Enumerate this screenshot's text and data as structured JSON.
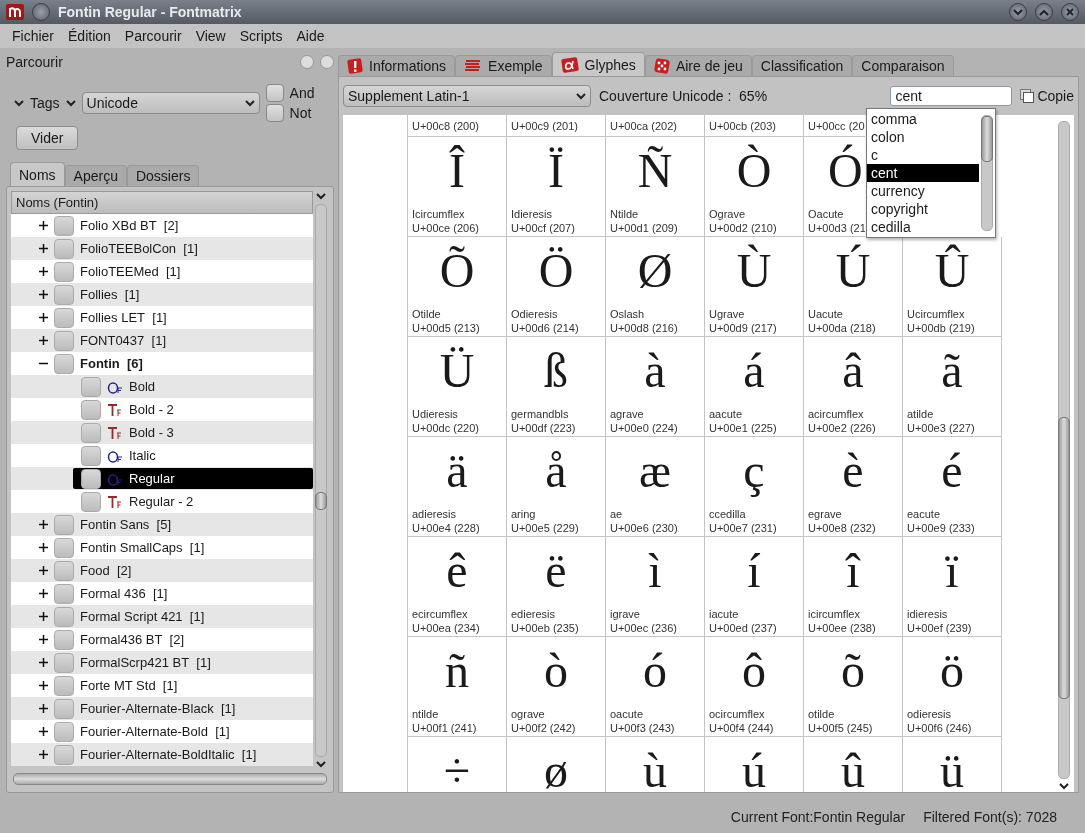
{
  "window": {
    "title": "Fontin Regular - Fontmatrix"
  },
  "menu": [
    "Fichier",
    "Édition",
    "Parcourir",
    "View",
    "Scripts",
    "Aide"
  ],
  "browse_panel": {
    "title": "Parcourir",
    "tags_label": "Tags",
    "tag_select": "Unicode",
    "filters": [
      {
        "label": "And",
        "checked": false
      },
      {
        "label": "Not",
        "checked": false
      }
    ],
    "clear_button": "Vider",
    "tabs": [
      {
        "label": "Noms",
        "selected": true
      },
      {
        "label": "Aperçu",
        "selected": false
      },
      {
        "label": "Dossiers",
        "selected": false
      }
    ],
    "tree": {
      "header": "Noms (Fontin)",
      "items": [
        {
          "label": "Folio XBd BT",
          "count": "[2]",
          "checked": false,
          "expanded": false
        },
        {
          "label": "FolioTEEBolCon",
          "count": "[1]",
          "checked": false,
          "expanded": false
        },
        {
          "label": "FolioTEEMed",
          "count": "[1]",
          "checked": false,
          "expanded": false
        },
        {
          "label": "Follies",
          "count": "[1]",
          "checked": false,
          "expanded": false
        },
        {
          "label": "Follies LET",
          "count": "[1]",
          "checked": false,
          "expanded": false
        },
        {
          "label": "FONT0437",
          "count": "[1]",
          "checked": false,
          "expanded": false
        },
        {
          "label": "Fontin",
          "count": "[6]",
          "checked": false,
          "expanded": true,
          "current": true,
          "children": [
            {
              "label": "Bold",
              "kind": "otf",
              "checked": false,
              "selected": false
            },
            {
              "label": "Bold - 2",
              "kind": "ttf",
              "checked": false,
              "selected": false
            },
            {
              "label": "Bold - 3",
              "kind": "ttf",
              "checked": false,
              "selected": false
            },
            {
              "label": "Italic",
              "kind": "otf",
              "checked": false,
              "selected": false
            },
            {
              "label": "Regular",
              "kind": "otf",
              "checked": false,
              "selected": true
            },
            {
              "label": "Regular - 2",
              "kind": "ttf",
              "checked": false,
              "selected": false
            }
          ]
        },
        {
          "label": "Fontin Sans",
          "count": "[5]",
          "checked": false,
          "expanded": false
        },
        {
          "label": "Fontin SmallCaps",
          "count": "[1]",
          "checked": false,
          "expanded": false
        },
        {
          "label": "Food",
          "count": "[2]",
          "checked": false,
          "expanded": false
        },
        {
          "label": "Formal 436",
          "count": "[1]",
          "checked": false,
          "expanded": false
        },
        {
          "label": "Formal Script 421",
          "count": "[1]",
          "checked": false,
          "expanded": false
        },
        {
          "label": "Formal436 BT",
          "count": "[2]",
          "checked": false,
          "expanded": false
        },
        {
          "label": "FormalScrp421 BT",
          "count": "[1]",
          "checked": false,
          "expanded": false
        },
        {
          "label": "Forte MT Std",
          "count": "[1]",
          "checked": false,
          "expanded": false
        },
        {
          "label": "Fourier-Alternate-Black",
          "count": "[1]",
          "checked": false,
          "expanded": false
        },
        {
          "label": "Fourier-Alternate-Bold",
          "count": "[1]",
          "checked": false,
          "expanded": false
        },
        {
          "label": "Fourier-Alternate-BoldItalic",
          "count": "[1]",
          "checked": false,
          "expanded": false
        }
      ]
    }
  },
  "main": {
    "tabs": [
      {
        "label": "Informations",
        "selected": false
      },
      {
        "label": "Exemple",
        "selected": false
      },
      {
        "label": "Glyphes",
        "selected": true
      },
      {
        "label": "Aire de jeu",
        "selected": false
      },
      {
        "label": "Classification",
        "selected": false
      },
      {
        "label": "Comparaison",
        "selected": false
      }
    ],
    "block_select": "Supplement Latin-1",
    "coverage": "Couverture Unicode :  65%",
    "search": {
      "value": "cent"
    },
    "copy_button": "Copie",
    "suggestions": [
      {
        "label": "comma",
        "selected": false
      },
      {
        "label": "colon",
        "selected": false
      },
      {
        "label": "c",
        "selected": false
      },
      {
        "label": "cent",
        "selected": true
      },
      {
        "label": "currency",
        "selected": false
      },
      {
        "label": "copyright",
        "selected": false
      },
      {
        "label": "cedilla",
        "selected": false
      }
    ],
    "glyph_rows": [
      [
        {
          "code": "U+00c8 (200)"
        },
        {
          "code": "U+00c9 (201)"
        },
        {
          "code": "U+00ca (202)"
        },
        {
          "code": "U+00cb (203)"
        },
        {
          "code": "U+00cc (20"
        }
      ],
      [
        {
          "glyph": "Î",
          "name": "Icircumflex",
          "code": "U+00ce (206)"
        },
        {
          "glyph": "Ï",
          "name": "Idieresis",
          "code": "U+00cf (207)"
        },
        {
          "glyph": "Ñ",
          "name": "Ntilde",
          "code": "U+00d1 (209)"
        },
        {
          "glyph": "Ò",
          "name": "Ograve",
          "code": "U+00d2 (210)"
        },
        {
          "glyph": "Ó",
          "name": "Oacute",
          "code": "U+00d3 (21"
        }
      ],
      [
        {
          "glyph": "Õ",
          "name": "Otilde",
          "code": "U+00d5 (213)"
        },
        {
          "glyph": "Ö",
          "name": "Odieresis",
          "code": "U+00d6 (214)"
        },
        {
          "glyph": "Ø",
          "name": "Oslash",
          "code": "U+00d8 (216)"
        },
        {
          "glyph": "Ù",
          "name": "Ugrave",
          "code": "U+00d9 (217)"
        },
        {
          "glyph": "Ú",
          "name": "Uacute",
          "code": "U+00da (218)"
        },
        {
          "glyph": "Û",
          "name": "Ucircumflex",
          "code": "U+00db (219)"
        }
      ],
      [
        {
          "glyph": "Ü",
          "name": "Udieresis",
          "code": "U+00dc (220)"
        },
        {
          "glyph": "ß",
          "name": "germandbls",
          "code": "U+00df (223)"
        },
        {
          "glyph": "à",
          "name": "agrave",
          "code": "U+00e0 (224)"
        },
        {
          "glyph": "á",
          "name": "aacute",
          "code": "U+00e1 (225)"
        },
        {
          "glyph": "â",
          "name": "acircumflex",
          "code": "U+00e2 (226)"
        },
        {
          "glyph": "ã",
          "name": "atilde",
          "code": "U+00e3 (227)"
        }
      ],
      [
        {
          "glyph": "ä",
          "name": "adieresis",
          "code": "U+00e4 (228)"
        },
        {
          "glyph": "å",
          "name": "aring",
          "code": "U+00e5 (229)"
        },
        {
          "glyph": "æ",
          "name": "ae",
          "code": "U+00e6 (230)"
        },
        {
          "glyph": "ç",
          "name": "ccedilla",
          "code": "U+00e7 (231)"
        },
        {
          "glyph": "è",
          "name": "egrave",
          "code": "U+00e8 (232)"
        },
        {
          "glyph": "é",
          "name": "eacute",
          "code": "U+00e9 (233)"
        }
      ],
      [
        {
          "glyph": "ê",
          "name": "ecircumflex",
          "code": "U+00ea (234)"
        },
        {
          "glyph": "ë",
          "name": "edieresis",
          "code": "U+00eb (235)"
        },
        {
          "glyph": "ì",
          "name": "igrave",
          "code": "U+00ec (236)"
        },
        {
          "glyph": "í",
          "name": "iacute",
          "code": "U+00ed (237)"
        },
        {
          "glyph": "î",
          "name": "icircumflex",
          "code": "U+00ee (238)"
        },
        {
          "glyph": "ï",
          "name": "idieresis",
          "code": "U+00ef (239)"
        }
      ],
      [
        {
          "glyph": "ñ",
          "name": "ntilde",
          "code": "U+00f1 (241)"
        },
        {
          "glyph": "ò",
          "name": "ograve",
          "code": "U+00f2 (242)"
        },
        {
          "glyph": "ó",
          "name": "oacute",
          "code": "U+00f3 (243)"
        },
        {
          "glyph": "ô",
          "name": "ocircumflex",
          "code": "U+00f4 (244)"
        },
        {
          "glyph": "õ",
          "name": "otilde",
          "code": "U+00f5 (245)"
        },
        {
          "glyph": "ö",
          "name": "odieresis",
          "code": "U+00f6 (246)"
        }
      ],
      [
        {
          "glyph": "÷"
        },
        {
          "glyph": "ø"
        },
        {
          "glyph": "ù"
        },
        {
          "glyph": "ú"
        },
        {
          "glyph": "û"
        },
        {
          "glyph": "ü"
        }
      ]
    ]
  },
  "status_bar": [
    "Current Font:Fontin Regular",
    "Filtered Font(s): 7028"
  ]
}
